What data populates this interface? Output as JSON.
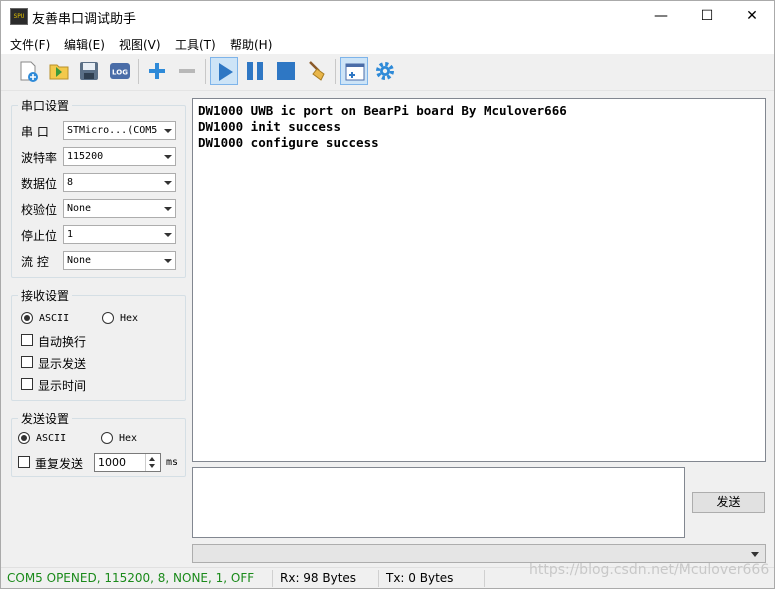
{
  "window": {
    "title": "友善串口调试助手",
    "app_icon_text": "SPU",
    "minimize_glyph": "—",
    "maximize_glyph": "☐",
    "close_glyph": "✕"
  },
  "menu": [
    "文件(F)",
    "编辑(E)",
    "视图(V)",
    "工具(T)",
    "帮助(H)"
  ],
  "toolbar": {
    "icons": [
      "new-file-icon",
      "open-folder-icon",
      "save-icon",
      "log-icon",
      "add-icon",
      "remove-icon",
      "play-icon",
      "pause-icon",
      "stop-icon",
      "broom-icon",
      "window-layout-icon",
      "settings-gear-icon"
    ],
    "log_text": "LOG",
    "colors": {
      "blue": "#2e77c4",
      "active_bg": "#cde4f7"
    }
  },
  "serial_settings": {
    "title": "串口设置",
    "port_label": "串 口",
    "port_value": "STMicro...(COM5",
    "baud_label": "波特率",
    "baud_value": "115200",
    "databits_label": "数据位",
    "databits_value": "8",
    "parity_label": "校验位",
    "parity_value": "None",
    "stopbits_label": "停止位",
    "stopbits_value": "1",
    "flow_label": "流 控",
    "flow_value": "None"
  },
  "receive_settings": {
    "title": "接收设置",
    "ascii_label": "ASCII",
    "hex_label": "Hex",
    "selected": "ASCII",
    "auto_wrap_label": "自动换行",
    "show_send_label": "显示发送",
    "show_time_label": "显示时间"
  },
  "send_settings": {
    "title": "发送设置",
    "ascii_label": "ASCII",
    "hex_label": "Hex",
    "selected": "ASCII",
    "repeat_label": "重复发送",
    "interval_value": "1000",
    "interval_unit": "ms"
  },
  "receive_area": {
    "lines": [
      "DW1000 UWB ic port on BearPi board By Mculover666",
      "DW1000 init success",
      "DW1000 configure success"
    ]
  },
  "send_area": {
    "text": "",
    "send_button": "发送"
  },
  "status": {
    "port_status": "COM5 OPENED, 115200, 8, NONE, 1, OFF",
    "port_status_color": "#1a8a1a",
    "rx": "Rx: 98 Bytes",
    "tx": "Tx: 0 Bytes"
  },
  "watermark": "https://blog.csdn.net/Mculover666"
}
